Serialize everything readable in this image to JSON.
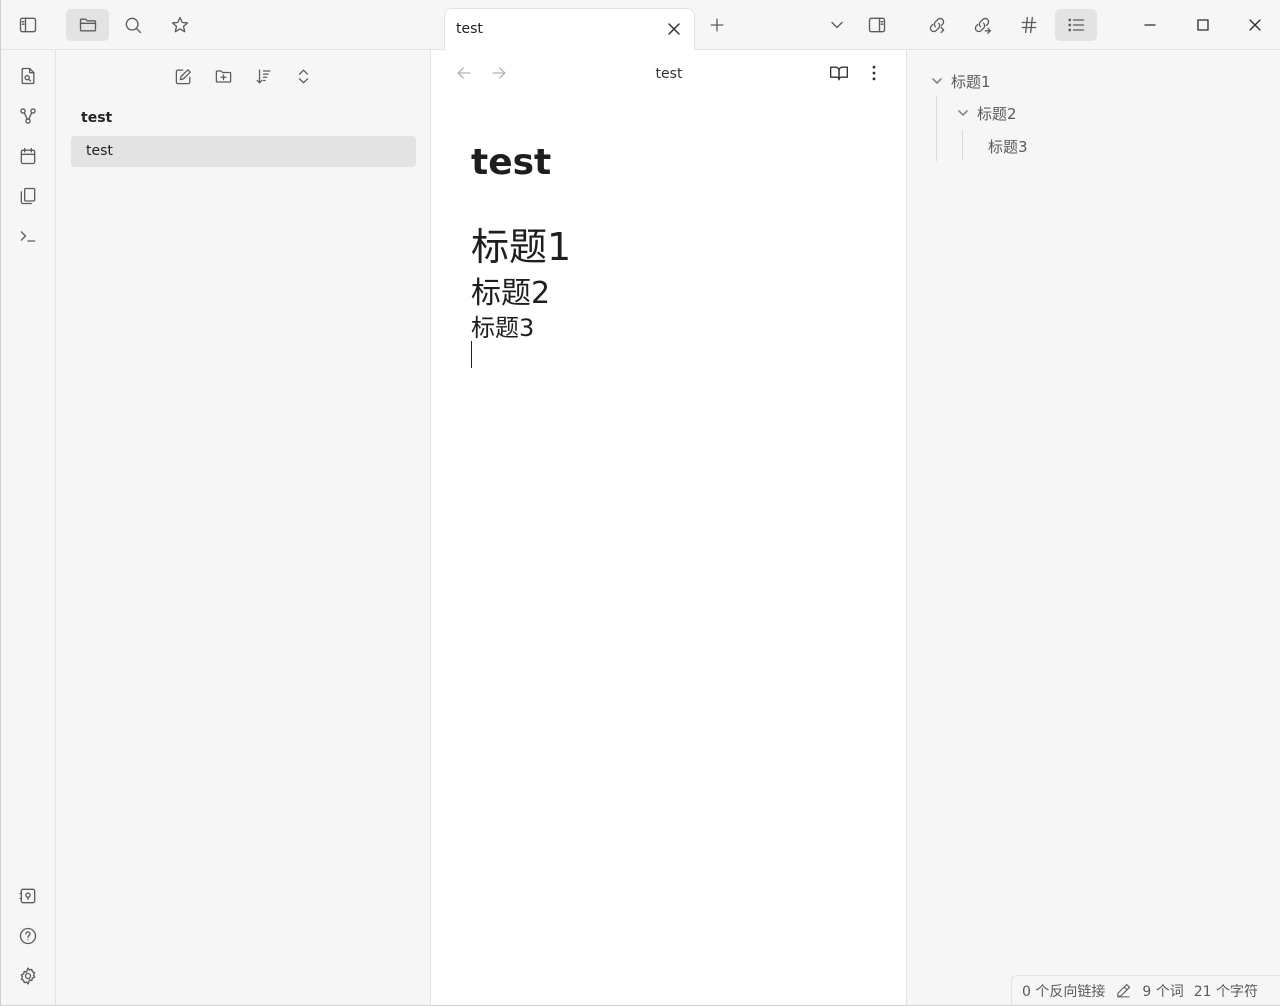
{
  "app": {
    "tab_title": "test",
    "view_title": "test"
  },
  "file_explorer": {
    "vault_name": "test",
    "files": [
      {
        "name": "test",
        "selected": true
      }
    ]
  },
  "document": {
    "title": "test",
    "headings": [
      {
        "level": 1,
        "text": "标题1"
      },
      {
        "level": 2,
        "text": "标题2"
      },
      {
        "level": 3,
        "text": "标题3"
      }
    ]
  },
  "outline": {
    "items": [
      {
        "level": 1,
        "text": "标题1",
        "collapsible": true
      },
      {
        "level": 2,
        "text": "标题2",
        "collapsible": true
      },
      {
        "level": 3,
        "text": "标题3",
        "collapsible": false
      }
    ]
  },
  "status_bar": {
    "backlinks": "0 个反向链接",
    "words": "9 个词",
    "characters": "21 个字符"
  },
  "icons": {
    "left_ribbon_top": [
      "sidebar-toggle-icon",
      "folder-icon",
      "search-icon",
      "star-icon"
    ],
    "left_ribbon": [
      "open-quick-switcher-icon",
      "graph-icon",
      "calendar-icon",
      "templates-icon",
      "terminal-icon"
    ],
    "left_ribbon_bottom": [
      "vault-icon",
      "help-icon",
      "settings-icon"
    ],
    "file_actions": [
      "new-note-icon",
      "new-folder-icon",
      "sort-icon",
      "collapse-expand-icon"
    ],
    "right_sidebar_tabs": [
      "backlinks-icon",
      "outgoing-links-icon",
      "tags-icon",
      "outline-icon"
    ]
  },
  "colors": {
    "panel_bg": "#f6f6f6",
    "active_bg": "#e3e3e3",
    "text": "#1e1e1e"
  }
}
